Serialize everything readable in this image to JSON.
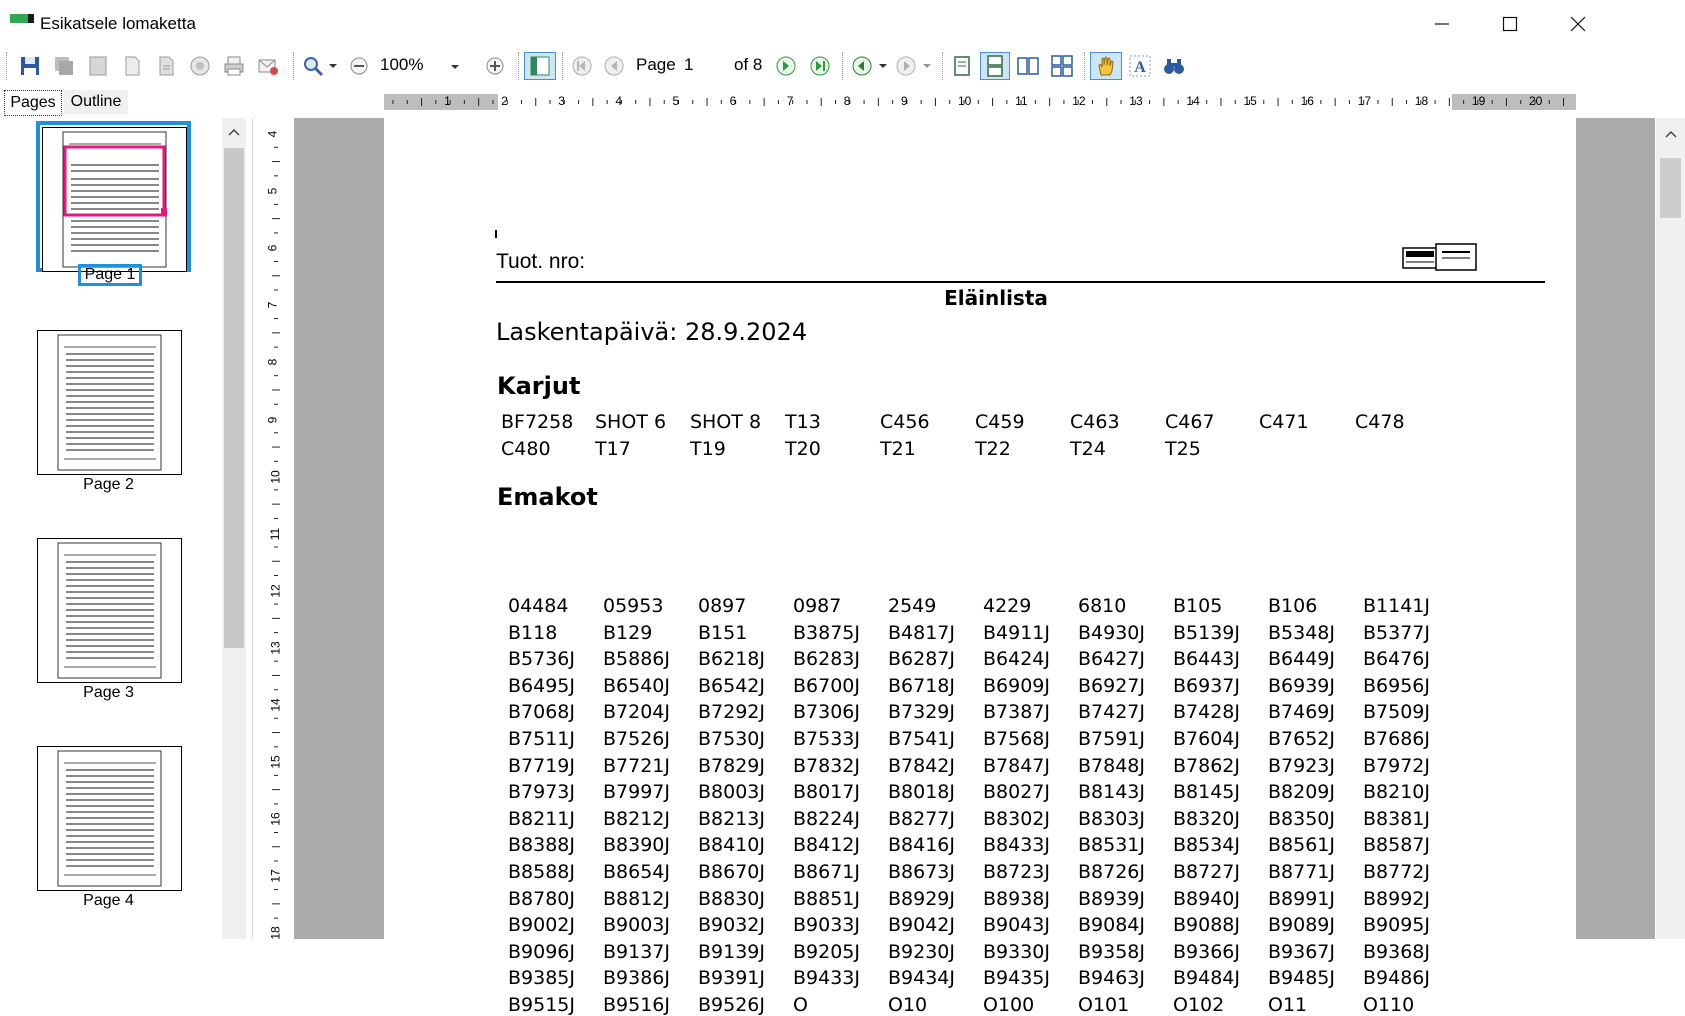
{
  "window": {
    "title": "Esikatsele lomaketta"
  },
  "toolbar": {
    "zoom_value": "100%",
    "page_label": "Page",
    "page_value": "1",
    "page_of": "of 8"
  },
  "tabs": [
    {
      "label": "Pages"
    },
    {
      "label": "Outline"
    }
  ],
  "hruler_labels": [
    "1",
    "2",
    "3",
    "4",
    "5",
    "6",
    "7",
    "8",
    "9",
    "10",
    "11",
    "12",
    "13",
    "14",
    "15",
    "16",
    "17",
    "18",
    "19",
    "20"
  ],
  "vruler_labels": [
    "4",
    "5",
    "6",
    "7",
    "8",
    "9",
    "10",
    "11",
    "12",
    "13",
    "14",
    "15",
    "16",
    "17",
    "18"
  ],
  "thumbnails": [
    {
      "label": "Page 1"
    },
    {
      "label": "Page 2"
    },
    {
      "label": "Page 3"
    },
    {
      "label": "Page 4"
    }
  ],
  "document": {
    "tuot_label": "Tuot. nro:",
    "list_title": "Eläinlista",
    "count_date": "Laskentapäivä: 28.9.2024",
    "karjut_heading": "Karjut",
    "karjut": [
      [
        "BF7258",
        "SHOT 6",
        "SHOT 8",
        "T13",
        "C456",
        "C459",
        "C463",
        "C467",
        "C471",
        "C478"
      ],
      [
        "C480",
        "T17",
        "T19",
        "T20",
        "T21",
        "T22",
        "T24",
        "T25"
      ]
    ],
    "emakot_heading": "Emakot",
    "emakot": [
      [
        "04484",
        "05953",
        "0897",
        "0987",
        "2549",
        "4229",
        "6810",
        "B105",
        "B106",
        "B1141J"
      ],
      [
        "B118",
        "B129",
        "B151",
        "B3875J",
        "B4817J",
        "B4911J",
        "B4930J",
        "B5139J",
        "B5348J",
        "B5377J"
      ],
      [
        "B5736J",
        "B5886J",
        "B6218J",
        "B6283J",
        "B6287J",
        "B6424J",
        "B6427J",
        "B6443J",
        "B6449J",
        "B6476J"
      ],
      [
        "B6495J",
        "B6540J",
        "B6542J",
        "B6700J",
        "B6718J",
        "B6909J",
        "B6927J",
        "B6937J",
        "B6939J",
        "B6956J"
      ],
      [
        "B7068J",
        "B7204J",
        "B7292J",
        "B7306J",
        "B7329J",
        "B7387J",
        "B7427J",
        "B7428J",
        "B7469J",
        "B7509J"
      ],
      [
        "B7511J",
        "B7526J",
        "B7530J",
        "B7533J",
        "B7541J",
        "B7568J",
        "B7591J",
        "B7604J",
        "B7652J",
        "B7686J"
      ],
      [
        "B7719J",
        "B7721J",
        "B7829J",
        "B7832J",
        "B7842J",
        "B7847J",
        "B7848J",
        "B7862J",
        "B7923J",
        "B7972J"
      ],
      [
        "B7973J",
        "B7997J",
        "B8003J",
        "B8017J",
        "B8018J",
        "B8027J",
        "B8143J",
        "B8145J",
        "B8209J",
        "B8210J"
      ],
      [
        "B8211J",
        "B8212J",
        "B8213J",
        "B8224J",
        "B8277J",
        "B8302J",
        "B8303J",
        "B8320J",
        "B8350J",
        "B8381J"
      ],
      [
        "B8388J",
        "B8390J",
        "B8410J",
        "B8412J",
        "B8416J",
        "B8433J",
        "B8531J",
        "B8534J",
        "B8561J",
        "B8587J"
      ],
      [
        "B8588J",
        "B8654J",
        "B8670J",
        "B8671J",
        "B8673J",
        "B8723J",
        "B8726J",
        "B8727J",
        "B8771J",
        "B8772J"
      ],
      [
        "B8780J",
        "B8812J",
        "B8830J",
        "B8851J",
        "B8929J",
        "B8938J",
        "B8939J",
        "B8940J",
        "B8991J",
        "B8992J"
      ],
      [
        "B9002J",
        "B9003J",
        "B9032J",
        "B9033J",
        "B9042J",
        "B9043J",
        "B9084J",
        "B9088J",
        "B9089J",
        "B9095J"
      ],
      [
        "B9096J",
        "B9137J",
        "B9139J",
        "B9205J",
        "B9230J",
        "B9330J",
        "B9358J",
        "B9366J",
        "B9367J",
        "B9368J"
      ],
      [
        "B9385J",
        "B9386J",
        "B9391J",
        "B9433J",
        "B9434J",
        "B9435J",
        "B9463J",
        "B9484J",
        "B9485J",
        "B9486J"
      ],
      [
        "B9515J",
        "B9516J",
        "B9526J",
        "O",
        "O10",
        "O100",
        "O101",
        "O102",
        "O11",
        "O110"
      ]
    ]
  },
  "colors": {
    "selection_blue": "#1e90e0",
    "thumb_highlight": "#e8177d",
    "play_green": "#2e9a3a"
  }
}
